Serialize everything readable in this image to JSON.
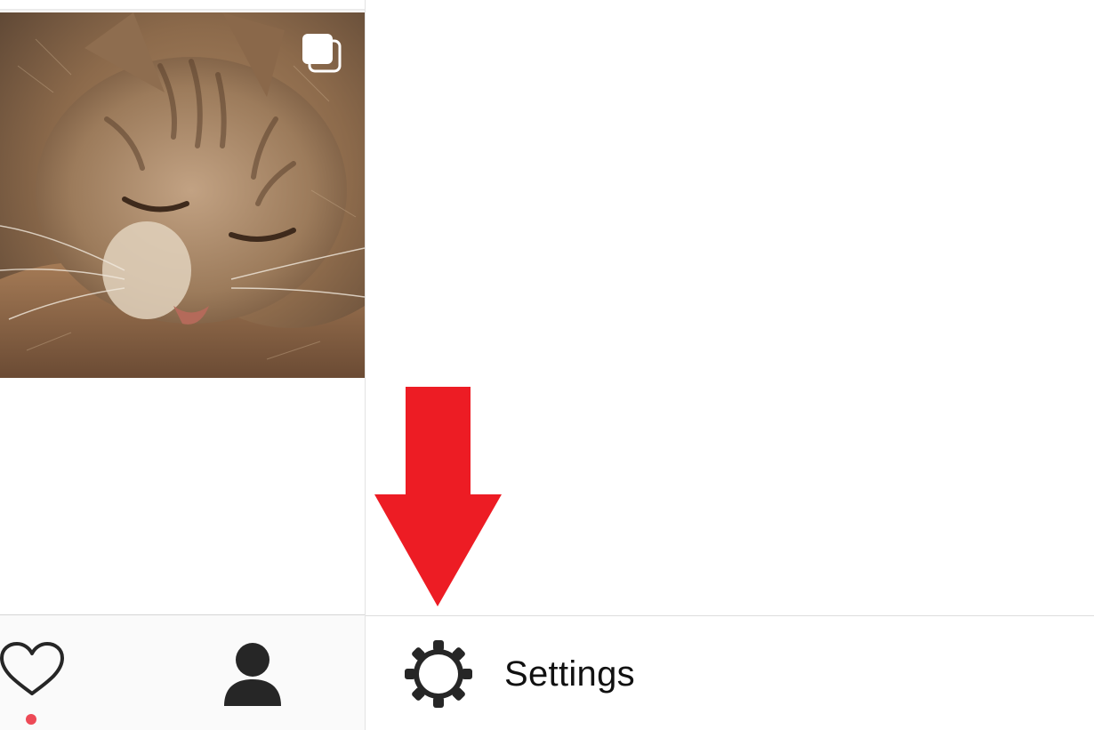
{
  "profile_grid": {
    "post": {
      "image_icon": "cat-photo",
      "overlay_icon": "carousel-multiple-icon"
    }
  },
  "tab_bar": {
    "activity_icon": "heart-icon",
    "profile_icon": "profile-person-icon",
    "notification_dot_color": "#ed4956"
  },
  "menu": {
    "settings": {
      "icon": "gear-icon",
      "label": "Settings"
    }
  },
  "annotation": {
    "arrow_icon": "red-down-arrow",
    "arrow_color": "#ed1c24"
  }
}
